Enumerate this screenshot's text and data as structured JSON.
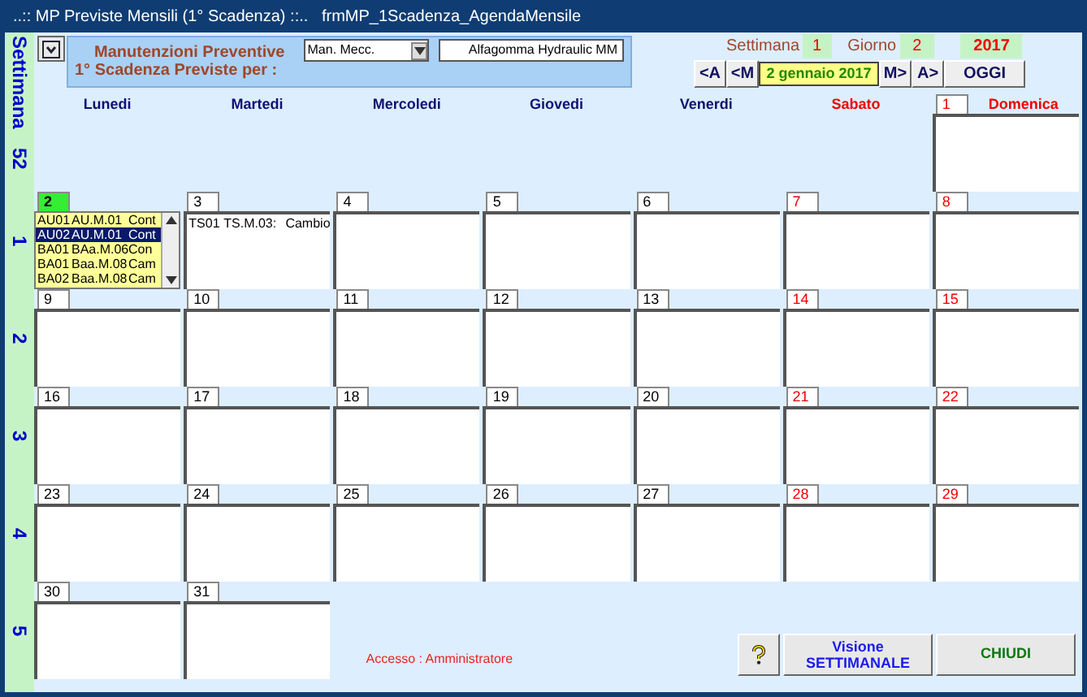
{
  "window": {
    "title": "..:: MP Previste Mensili (1° Scadenza) ::..   frmMP_1Scadenza_AgendaMensile"
  },
  "filter": {
    "label_line_1": "Manutenzioni Preventive",
    "label_line_2": "1° Scadenza Previste per :",
    "category": "Man. Mecc.",
    "supplier": "Alfagomma Hydraulic  MM"
  },
  "summary": {
    "week_label": "Settimana",
    "week": "1",
    "day_label": "Giorno",
    "day": "2",
    "year": "2017"
  },
  "navigation": {
    "prev_year": "<A",
    "prev_month": "<M",
    "date": "2 gennaio 2017",
    "next_month": "M>",
    "next_year": "A>",
    "today": "OGGI"
  },
  "week_column_label": "Settimana",
  "day_names": [
    {
      "label": "Lunedi",
      "holiday": false
    },
    {
      "label": "Martedi",
      "holiday": false
    },
    {
      "label": "Mercoledi",
      "holiday": false
    },
    {
      "label": "Giovedi",
      "holiday": false
    },
    {
      "label": "Venerdi",
      "holiday": false
    },
    {
      "label": "Sabato",
      "holiday": true
    },
    {
      "label": "Domenica",
      "holiday": true
    }
  ],
  "weeks": [
    {
      "number": "52",
      "days": [
        {
          "day": "1",
          "holiday": true,
          "selected": false,
          "kind": "plain"
        }
      ]
    },
    {
      "number": "1",
      "days": [
        {
          "day": "2",
          "holiday": false,
          "selected": true,
          "kind": "listbox",
          "entries": [
            {
              "code": "AU01",
              "ref": "AU.M.01",
              "desc": "Cont",
              "selected": false
            },
            {
              "code": "AU02",
              "ref": "AU.M.01",
              "desc": "Cont",
              "selected": true
            },
            {
              "code": "BA01",
              "ref": "BAa.M.06",
              "desc": "Con",
              "selected": false
            },
            {
              "code": "BA01",
              "ref": "Baa.M.08",
              "desc": "Cam",
              "selected": false
            },
            {
              "code": "BA02",
              "ref": "Baa.M.08",
              "desc": "Cam",
              "selected": false
            }
          ]
        },
        {
          "day": "3",
          "holiday": false,
          "selected": false,
          "kind": "plain",
          "entries": [
            {
              "code": "TS01",
              "ref": "TS.M.03:",
              "desc": "Cambio",
              "selected": false
            }
          ]
        },
        {
          "day": "4",
          "holiday": false,
          "selected": false,
          "kind": "plain"
        },
        {
          "day": "5",
          "holiday": false,
          "selected": false,
          "kind": "plain"
        },
        {
          "day": "6",
          "holiday": false,
          "selected": false,
          "kind": "plain"
        },
        {
          "day": "7",
          "holiday": true,
          "selected": false,
          "kind": "plain"
        },
        {
          "day": "8",
          "holiday": true,
          "selected": false,
          "kind": "plain"
        }
      ]
    },
    {
      "number": "2",
      "days": [
        {
          "day": "9",
          "holiday": false,
          "selected": false,
          "kind": "plain"
        },
        {
          "day": "10",
          "holiday": false,
          "selected": false,
          "kind": "plain"
        },
        {
          "day": "11",
          "holiday": false,
          "selected": false,
          "kind": "plain"
        },
        {
          "day": "12",
          "holiday": false,
          "selected": false,
          "kind": "plain"
        },
        {
          "day": "13",
          "holiday": false,
          "selected": false,
          "kind": "plain"
        },
        {
          "day": "14",
          "holiday": true,
          "selected": false,
          "kind": "plain"
        },
        {
          "day": "15",
          "holiday": true,
          "selected": false,
          "kind": "plain"
        }
      ]
    },
    {
      "number": "3",
      "days": [
        {
          "day": "16",
          "holiday": false,
          "selected": false,
          "kind": "plain"
        },
        {
          "day": "17",
          "holiday": false,
          "selected": false,
          "kind": "plain"
        },
        {
          "day": "18",
          "holiday": false,
          "selected": false,
          "kind": "plain"
        },
        {
          "day": "19",
          "holiday": false,
          "selected": false,
          "kind": "plain"
        },
        {
          "day": "20",
          "holiday": false,
          "selected": false,
          "kind": "plain"
        },
        {
          "day": "21",
          "holiday": true,
          "selected": false,
          "kind": "plain"
        },
        {
          "day": "22",
          "holiday": true,
          "selected": false,
          "kind": "plain"
        }
      ]
    },
    {
      "number": "4",
      "days": [
        {
          "day": "23",
          "holiday": false,
          "selected": false,
          "kind": "plain"
        },
        {
          "day": "24",
          "holiday": false,
          "selected": false,
          "kind": "plain"
        },
        {
          "day": "25",
          "holiday": false,
          "selected": false,
          "kind": "plain"
        },
        {
          "day": "26",
          "holiday": false,
          "selected": false,
          "kind": "plain"
        },
        {
          "day": "27",
          "holiday": false,
          "selected": false,
          "kind": "plain"
        },
        {
          "day": "28",
          "holiday": true,
          "selected": false,
          "kind": "plain"
        },
        {
          "day": "29",
          "holiday": true,
          "selected": false,
          "kind": "plain"
        }
      ]
    },
    {
      "number": "5",
      "days": [
        {
          "day": "30",
          "holiday": false,
          "selected": false,
          "kind": "plain"
        },
        {
          "day": "31",
          "holiday": false,
          "selected": false,
          "kind": "plain"
        }
      ]
    }
  ],
  "footer": {
    "access": "Accesso : Amministratore",
    "week_view_line_1": "Visione",
    "week_view_line_2": "SETTIMANALE",
    "close": "CHIUDI"
  }
}
